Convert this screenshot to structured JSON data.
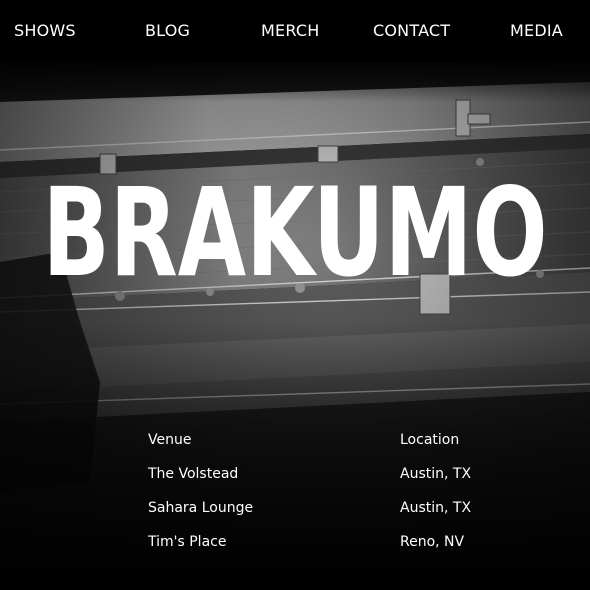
{
  "nav": {
    "items": [
      {
        "label": "SHOWS"
      },
      {
        "label": "BLOG"
      },
      {
        "label": "MERCH"
      },
      {
        "label": "CONTACT"
      },
      {
        "label": "MEDIA"
      }
    ]
  },
  "hero": {
    "title": "BRAKUMO"
  },
  "shows": {
    "headers": {
      "venue": "Venue",
      "location": "Location"
    },
    "rows": [
      {
        "venue": "The Volstead",
        "location": "Austin, TX"
      },
      {
        "venue": "Sahara Lounge",
        "location": "Austin, TX"
      },
      {
        "venue": "Tim's Place",
        "location": "Reno, NV"
      }
    ]
  },
  "colors": {
    "background": "#000000",
    "text": "#ffffff"
  }
}
